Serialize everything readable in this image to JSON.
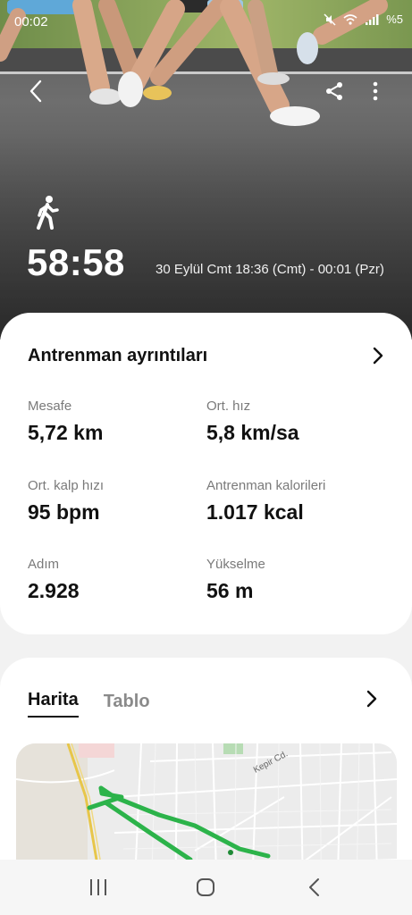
{
  "status_bar": {
    "time": "00:02",
    "battery_text": "%5"
  },
  "header": {
    "duration": "58:58",
    "date_range": "30 Eylül Cmt 18:36 (Cmt) - 00:01 (Pzr)",
    "activity_icon": "walking-icon"
  },
  "details": {
    "title": "Antrenman ayrıntıları",
    "stats": [
      {
        "label": "Mesafe",
        "value": "5,72 km"
      },
      {
        "label": "Ort. hız",
        "value": "5,8 km/sa"
      },
      {
        "label": "Ort. kalp hızı",
        "value": "95 bpm"
      },
      {
        "label": "Antrenman kalorileri",
        "value": "1.017 kcal"
      },
      {
        "label": "Adım",
        "value": "2.928"
      },
      {
        "label": "Yükselme",
        "value": "56 m"
      }
    ]
  },
  "map_section": {
    "tabs": [
      {
        "label": "Harita",
        "active": true
      },
      {
        "label": "Tablo",
        "active": false
      }
    ],
    "street_label": "Kepir Cd.",
    "route_color": "#2cb34a"
  }
}
